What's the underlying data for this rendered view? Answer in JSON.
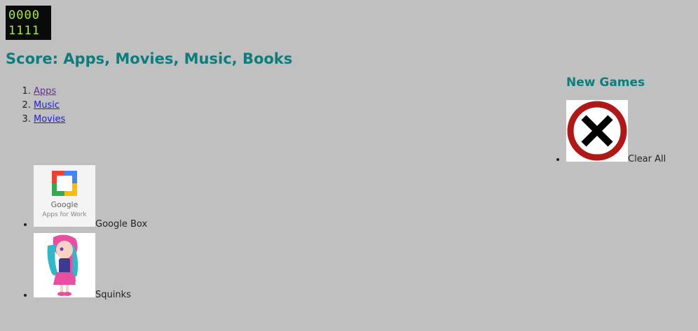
{
  "logo": {
    "line1": "0000",
    "line2": "1111"
  },
  "header": {
    "title": "Score: Apps, Movies, Music, Books"
  },
  "nav": {
    "items": [
      {
        "label": "Apps"
      },
      {
        "label": "Music"
      },
      {
        "label": "Movies"
      }
    ]
  },
  "sidebar": {
    "title": "New Games",
    "clear_label": "Clear All",
    "clear_icon": "close-circle-icon"
  },
  "games": {
    "items": [
      {
        "label": "Google Box",
        "thumb_caption_1": "Google",
        "thumb_caption_2": "Apps for Work"
      },
      {
        "label": "Squinks"
      }
    ]
  },
  "colors": {
    "background": "#c0c0c0",
    "heading": "#0b7d7d",
    "link": "#1a1aee",
    "visited": "#6a2a9a",
    "logo_text": "#a8e840"
  }
}
